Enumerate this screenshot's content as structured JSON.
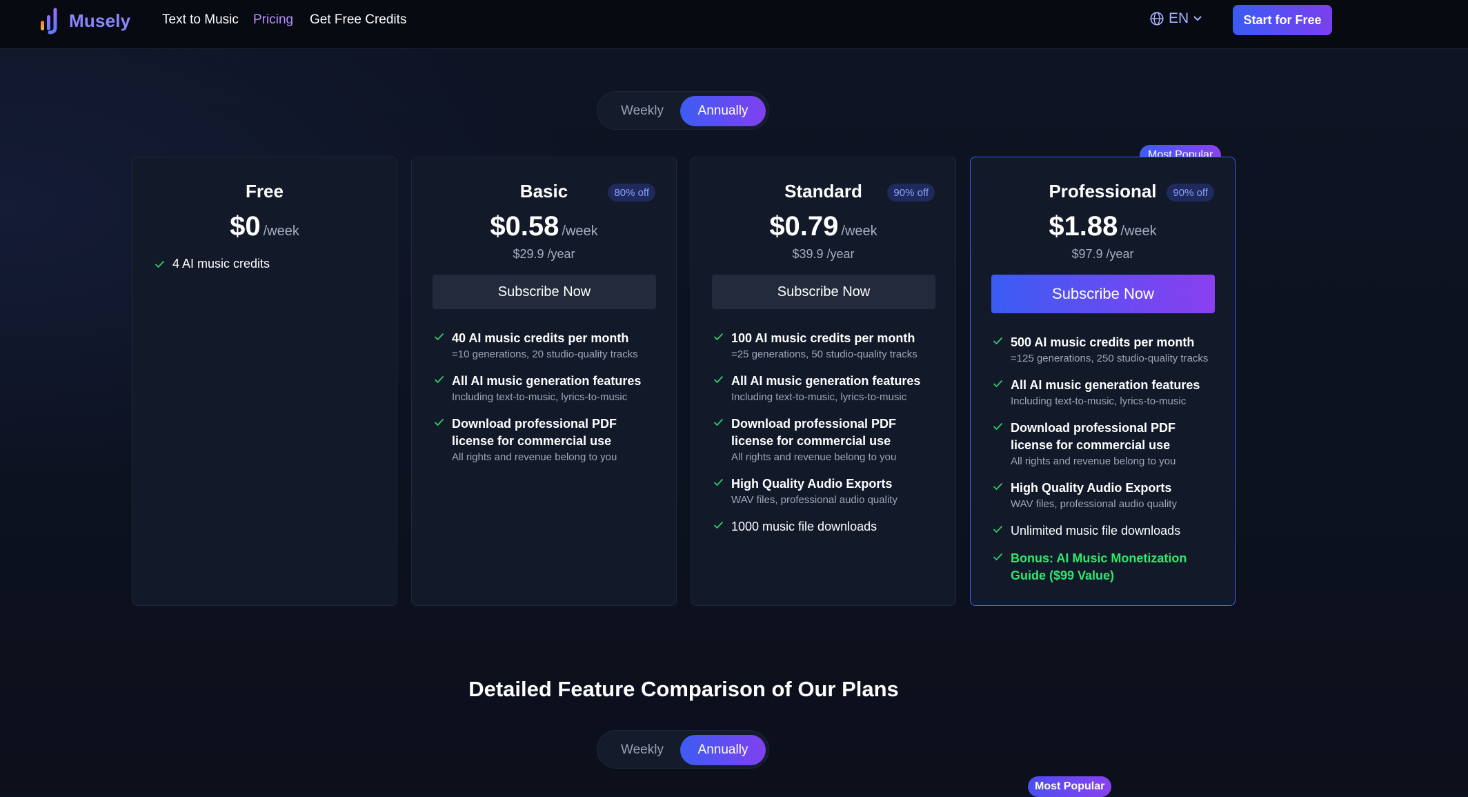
{
  "nav": {
    "brand": "Musely",
    "links": [
      "Text to Music",
      "Pricing",
      "Get Free Credits"
    ],
    "active_link": "Pricing",
    "language": "EN",
    "cta": "Start for Free"
  },
  "billing_toggle": {
    "weekly": "Weekly",
    "annually": "Annually",
    "selected": "Annually"
  },
  "most_popular": "Most Popular",
  "plans": [
    {
      "name": "Free",
      "price": "$0",
      "period": "/week",
      "features": [
        {
          "title": "4 AI music credits"
        }
      ]
    },
    {
      "name": "Basic",
      "discount": "80% off",
      "price": "$0.58",
      "period": "/week",
      "yearly": "$29.9 /year",
      "button": "Subscribe Now",
      "features": [
        {
          "title": "40 AI music credits per month",
          "sub": "=10 generations, 20 studio-quality tracks"
        },
        {
          "title": "All AI music generation features",
          "sub": "Including text-to-music, lyrics-to-music"
        },
        {
          "title": "Download professional PDF license for commercial use",
          "sub": "All rights and revenue belong to you"
        }
      ]
    },
    {
      "name": "Standard",
      "discount": "90% off",
      "price": "$0.79",
      "period": "/week",
      "yearly": "$39.9 /year",
      "button": "Subscribe Now",
      "features": [
        {
          "title": "100 AI music credits per month",
          "sub": "=25 generations, 50 studio-quality tracks"
        },
        {
          "title": "All AI music generation features",
          "sub": "Including text-to-music, lyrics-to-music"
        },
        {
          "title": "Download professional PDF license for commercial use",
          "sub": "All rights and revenue belong to you"
        },
        {
          "title": "High Quality Audio Exports",
          "sub": "WAV files, professional audio quality"
        },
        {
          "title": "1000 music file downloads"
        }
      ]
    },
    {
      "name": "Professional",
      "discount": "90% off",
      "price": "$1.88",
      "period": "/week",
      "yearly": "$97.9 /year",
      "button": "Subscribe Now",
      "features": [
        {
          "title": "500 AI music credits per month",
          "sub": "=125 generations, 250 studio-quality tracks"
        },
        {
          "title": "All AI music generation features",
          "sub": "Including text-to-music, lyrics-to-music"
        },
        {
          "title": "Download professional PDF license for commercial use",
          "sub": "All rights and revenue belong to you"
        },
        {
          "title": "High Quality Audio Exports",
          "sub": "WAV files, professional audio quality"
        },
        {
          "title": "Unlimited music file downloads"
        },
        {
          "title": "Bonus: AI Music Monetization Guide ($99 Value)"
        }
      ]
    }
  ],
  "comparison": {
    "title": "Detailed Feature Comparison of Our Plans",
    "toggle": {
      "weekly": "Weekly",
      "annually": "Annually"
    },
    "badge": "Most Popular"
  },
  "colors": {
    "accent_blue": "#3a5cf3",
    "accent_purple": "#8b3ff0",
    "check_green": "#2ecf6a",
    "bonus_green": "#2ee86e",
    "brand": "#8a86ff"
  }
}
